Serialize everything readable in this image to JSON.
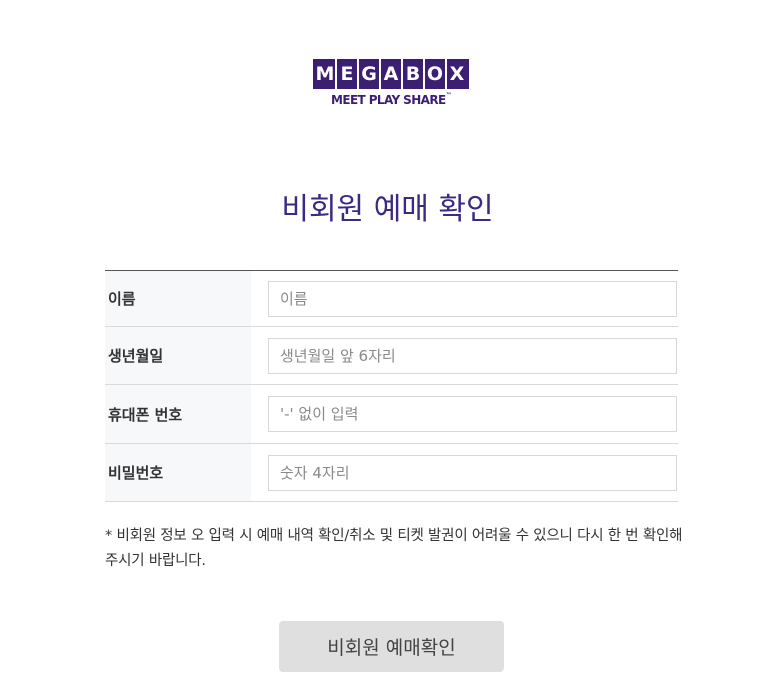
{
  "logo": {
    "letters": [
      "M",
      "E",
      "G",
      "A",
      "B",
      "O",
      "X"
    ],
    "tagline": "MEET PLAY SHARE",
    "trademark": "™"
  },
  "page": {
    "title": "비회원 예매 확인"
  },
  "form": {
    "rows": [
      {
        "label": "이름",
        "placeholder": "이름"
      },
      {
        "label": "생년월일",
        "placeholder": "생년월일 앞 6자리"
      },
      {
        "label": "휴대폰 번호",
        "placeholder": "'-' 없이 입력"
      },
      {
        "label": "비밀번호",
        "placeholder": "숫자 4자리"
      }
    ]
  },
  "notice": "* 비회원 정보 오 입력 시 예매 내역 확인/취소 및 티켓 발권이 어려울 수 있으니 다시 한 번 확인해 주시기 바랍니다.",
  "submit_button": {
    "label": "비회원 예매확인"
  },
  "colors": {
    "brand": "#3c1e73",
    "title": "#3c2a82",
    "button_bg": "#dfdfdf",
    "label_bg": "#f7f8fa"
  }
}
